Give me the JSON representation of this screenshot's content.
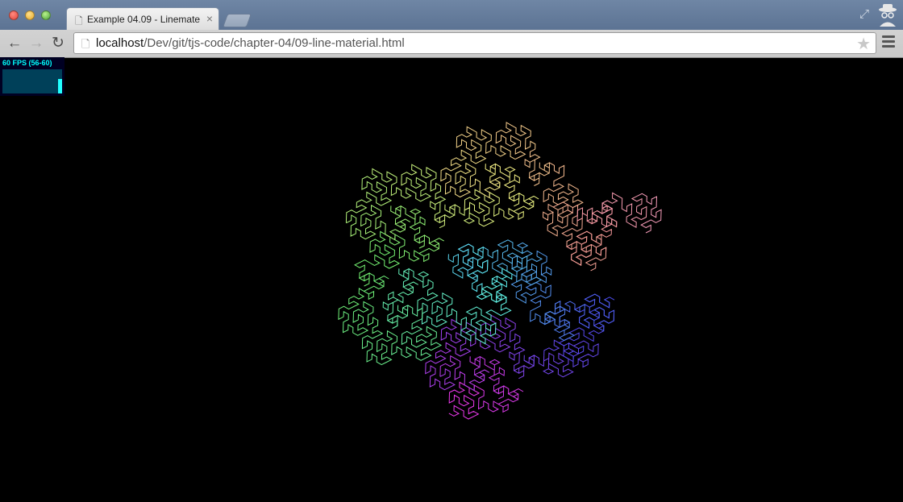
{
  "browser": {
    "tab_title": "Example 04.09 - Linemate",
    "tab_close": "×",
    "url_host": "localhost",
    "url_path": "/Dev/git/tjs-code/chapter-04/09-line-material.html"
  },
  "stats": {
    "fps_label": "60 FPS (56-60)"
  },
  "scene": {
    "background": "#000000",
    "palette": [
      "#ffffff",
      "#44ff44",
      "#44ffff",
      "#4444ff",
      "#ff44ff",
      "#ff8844"
    ]
  }
}
